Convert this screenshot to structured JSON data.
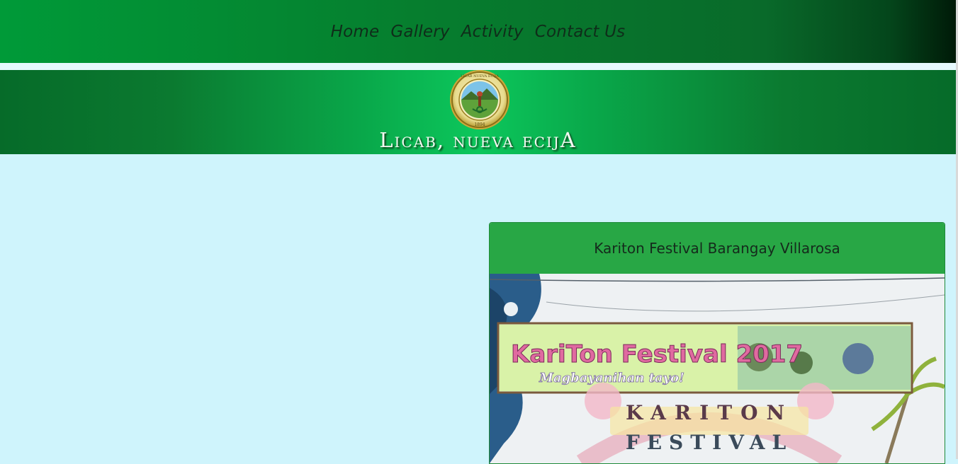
{
  "nav": {
    "items": [
      {
        "label": "Home"
      },
      {
        "label": "Gallery"
      },
      {
        "label": "Activity"
      },
      {
        "label": "Contact Us"
      }
    ]
  },
  "banner": {
    "title": "Licab, nueva ecijA",
    "seal_icon": "municipal-seal-icon",
    "seal_text": "LICAB NUEVA ECIJA",
    "seal_year": "1894"
  },
  "card": {
    "title": "Kariton Festival Barangay Villarosa",
    "image": {
      "banner_text": "KariTon Festival 2017",
      "subtitle_text": "Magbayanihan tayo!",
      "arch_line1": "KARITON",
      "arch_line2": "FESTIVAL"
    }
  },
  "colors": {
    "page_bg": "#cff4fc",
    "nav_green": "#067d2e",
    "card_header": "#28a745"
  }
}
